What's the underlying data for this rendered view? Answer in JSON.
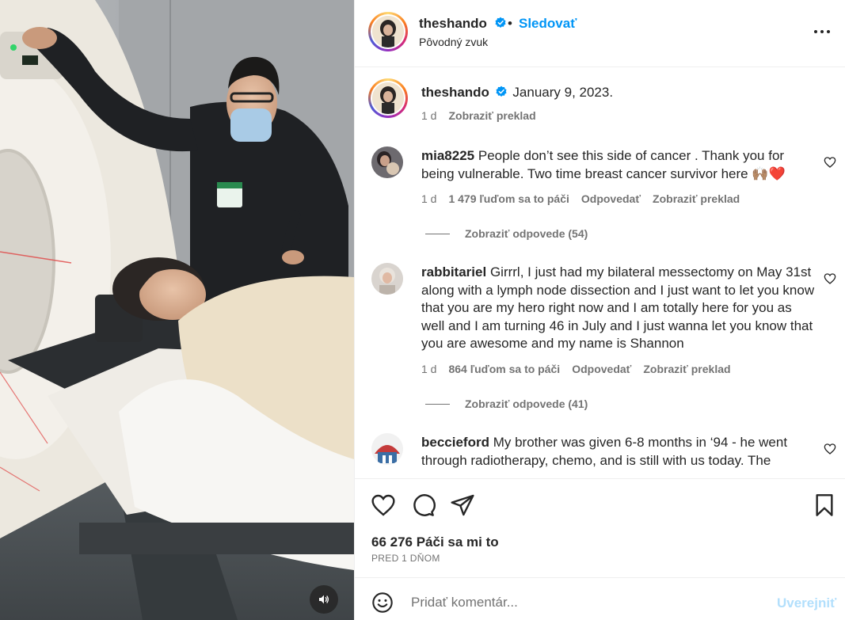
{
  "post": {
    "username": "theshando",
    "follow_label": "Sledovať",
    "separator": "•",
    "audio_label": "Pôvodný zvuk",
    "more_icon": "more-horizontal-icon"
  },
  "caption": {
    "username": "theshando",
    "text": "January 9, 2023.",
    "age": "1 d",
    "translate": "Zobraziť preklad"
  },
  "comments": [
    {
      "username": "mia8225",
      "text": "People don’t see this side of cancer . Thank you for being vulnerable. Two time breast cancer survivor here 🙌🏽❤️",
      "age": "1 d",
      "likes": "1 479 ľuďom sa to páči",
      "reply": "Odpovedať",
      "translate": "Zobraziť preklad",
      "view_replies": "Zobraziť odpovede (54)"
    },
    {
      "username": "rabbitariel",
      "text": "Girrrl, I just had my bilateral messectomy on May 31st along with a lymph node dissection and I just want to let you know that you are my hero right now and I am totally here for you as well and I am turning 46 in July and I just wanna let you know that you are awesome and my name is Shannon",
      "age": "1 d",
      "likes": "864 ľuďom sa to páči",
      "reply": "Odpovedať",
      "translate": "Zobraziť preklad",
      "view_replies": "Zobraziť odpovede (41)"
    },
    {
      "username": "beccieford",
      "text": "My brother was given 6-8 months in ‘94 - he went through radiotherapy, chemo, and is still with us today. The",
      "age": "",
      "likes": "",
      "reply": "",
      "translate": "",
      "view_replies": ""
    }
  ],
  "actions": {
    "like_count": "66 276 Páči sa mi to",
    "posted": "PRED 1 DŇOM"
  },
  "composer": {
    "placeholder": "Pridať komentár...",
    "post_label": "Uverejniť"
  },
  "colors": {
    "accent": "#0095f6",
    "verified": "#0095f6",
    "muted_text": "#737373",
    "post_disabled": "#b2dffc"
  }
}
